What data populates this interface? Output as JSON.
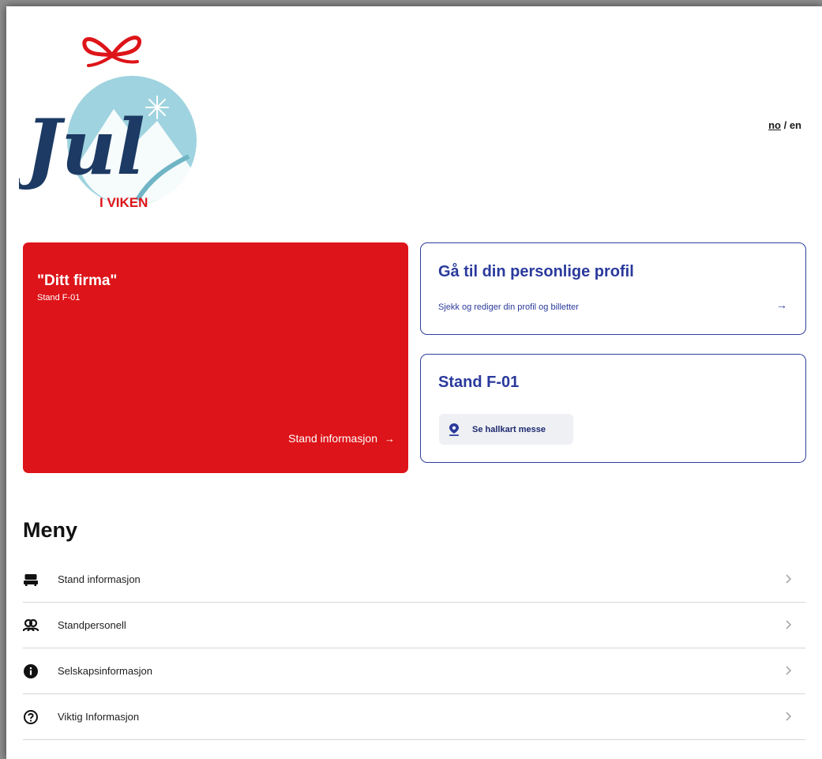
{
  "logo": {
    "script": "Jul",
    "subtitle": "I VIKEN",
    "alt": "Jul i Viken"
  },
  "lang": {
    "no": "no",
    "separator": "/",
    "en": "en",
    "active": "no"
  },
  "company_card": {
    "name": "\"Ditt firma\"",
    "stand": "Stand F-01",
    "link": "Stand informasjon",
    "arrow": "→"
  },
  "profile_card": {
    "title": "Gå til din personlige profil",
    "subtitle": "Sjekk og rediger din profil og billetter",
    "arrow": "→"
  },
  "stand_card": {
    "title": "Stand F-01",
    "map_button": "Se hallkart messe"
  },
  "menu": {
    "title": "Meny",
    "items": [
      {
        "label": "Stand informasjon",
        "icon": "stand-icon"
      },
      {
        "label": "Standpersonell",
        "icon": "people-icon"
      },
      {
        "label": "Selskapsinformasjon",
        "icon": "info-icon"
      },
      {
        "label": "Viktig Informasjon",
        "icon": "question-icon"
      }
    ]
  },
  "colors": {
    "red": "#dd1419",
    "navy": "#2a3a9c",
    "logo_navy": "#1c3a63",
    "logo_teal": "#9fd3df"
  }
}
